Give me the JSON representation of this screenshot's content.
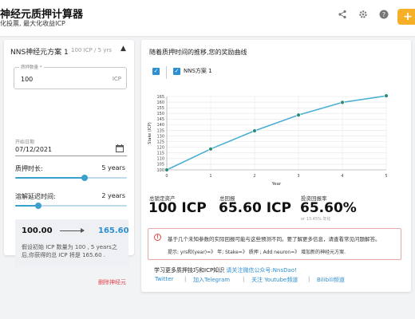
{
  "header": {
    "title": "神经元质押计算器",
    "subtitle": "化投票, 最大化收益ICP",
    "icons": [
      "share-icon",
      "gear-icon",
      "help-icon"
    ],
    "add_label": "+"
  },
  "plan": {
    "title": "NNS神经元方案 1",
    "meta": "100 ICP / 5 yrs",
    "stake_label": "质押数量 *",
    "stake_value": "100",
    "stake_unit": "ICP",
    "date_label": "开始日期",
    "date_value": "07/12/2021",
    "lock_label": "质押时长:",
    "lock_value": "5 years",
    "lock_fraction": 0.62,
    "dissolve_label": "溶解延迟时间:",
    "dissolve_value": "2 years",
    "dissolve_fraction": 0.21,
    "result_from": "100.00",
    "result_to": "165.60",
    "result_desc": "假设初始 ICP 数量为 100 , 5 years之后,你获得的总 ICP 将是 165.60 .",
    "delete_label": "删除神经元"
  },
  "chart_panel": {
    "heading": "随着质押时间的推移,您的奖励曲线",
    "legend_label": "NNS方案 1",
    "check": "✓"
  },
  "stats": {
    "total_label": "总锁定资产",
    "total_value": "100 ICP",
    "return_label": "总回报",
    "return_value": "65.60 ICP",
    "rate_label": "投资回报率",
    "rate_value": "65.60%",
    "rate_sub": "or 13.45% 年化"
  },
  "warning": {
    "text": "基于几个未知参数的实际回报可能与这些预测不同。要了解更多信息，请查看常见问题解答。",
    "hint": "提示: yrs和(year)=》 年; Stake=》 质押 ; Add neuron=》 增加新的神经元方案."
  },
  "learn": {
    "text": "学习更多质押技巧和ICP知识",
    "wechat": "请关注微信公众号:NnsDao!",
    "links": [
      "Twitter",
      "加入Telegram",
      "关注 Youtube频道",
      "Bilibili频道"
    ]
  },
  "colors": {
    "accent": "#2e8fd0",
    "line": "#4bafd3",
    "warning": "#e0434a",
    "add_button": "#f5b028"
  },
  "chart_data": {
    "type": "line",
    "x": [
      0,
      1,
      2,
      3,
      4,
      5
    ],
    "series": [
      {
        "name": "NNS方案 1",
        "values": [
          100,
          118.5,
          134.6,
          148.6,
          159.8,
          165.6
        ]
      }
    ],
    "xlabel": "Year",
    "ylabel": "Stake (ICP)",
    "xlim": [
      0,
      5
    ],
    "ylim": [
      100,
      165
    ],
    "yticks": [
      100,
      105,
      110,
      115,
      120,
      125,
      130,
      135,
      140,
      145,
      150,
      155,
      160,
      165
    ],
    "grid": true
  }
}
